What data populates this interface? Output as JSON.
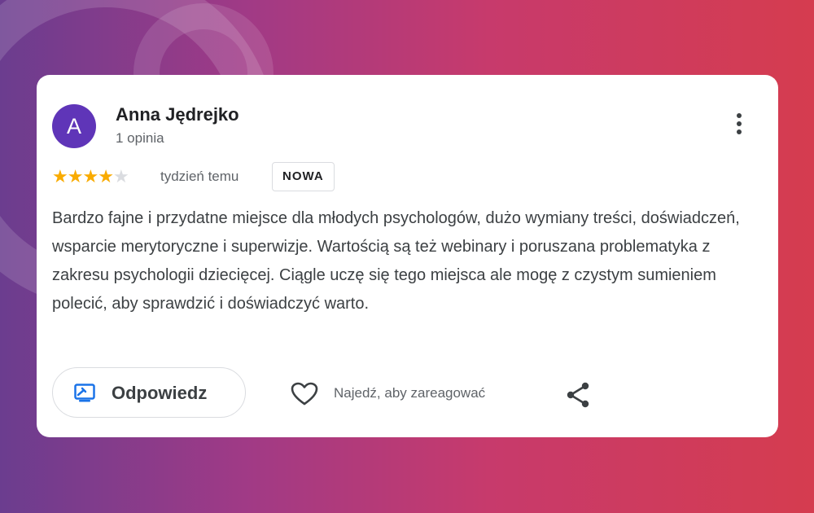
{
  "review": {
    "author_initial": "A",
    "author_name": "Anna Jędrejko",
    "review_count": "1 opinia",
    "rating": 4,
    "rating_max": 5,
    "time": "tydzień temu",
    "badge": "NOWA",
    "text": "Bardzo fajne i przydatne miejsce dla młodych psychologów, dużo wymiany treści, doświadczeń, wsparcie merytoryczne i superwizje. Wartością są też webinary i poruszana problematyka z zakresu psychologii dziecięcej. Ciągle uczę się tego miejsca ale mogę z czystym sumieniem polecić, aby sprawdzić i doświadczyć warto."
  },
  "actions": {
    "reply_label": "Odpowiedz",
    "react_label": "Najedź, aby zareagować"
  },
  "icons": {
    "more": "more-vert-icon",
    "reply": "reply-icon",
    "heart": "heart-icon",
    "share": "share-icon"
  },
  "colors": {
    "avatar": "#5f35b8",
    "star": "#f9ab00",
    "reply_icon": "#1a73e8",
    "bg_left": "#6b3d8f",
    "bg_right": "#d53c4f"
  }
}
